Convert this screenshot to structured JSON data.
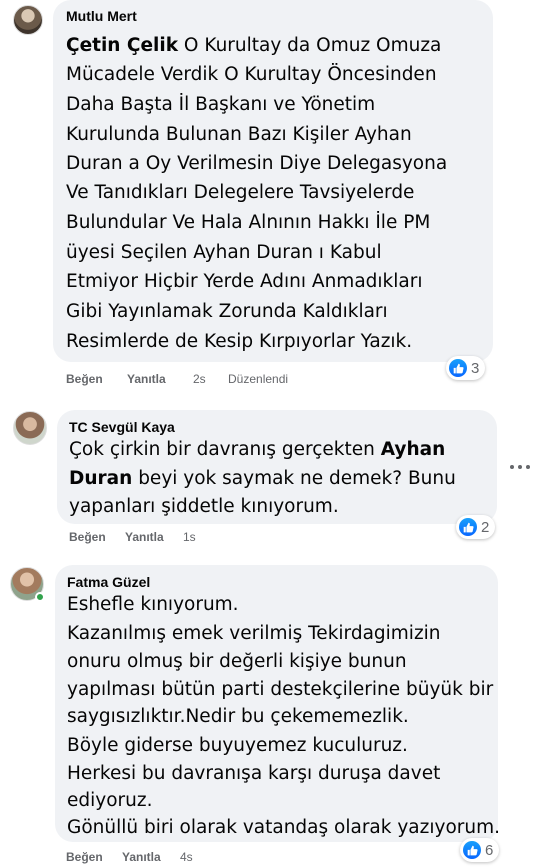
{
  "comments": [
    {
      "author": "Mutlu Mert",
      "mention": "Çetin Çelik",
      "lines": [
        " O Kurultay da Omuz Omuza",
        "Mücadele Verdik O Kurultay Öncesinden",
        "Daha Başta İl Başkanı ve Yönetim",
        "Kurulunda Bulunan Bazı Kişiler Ayhan",
        "Duran a Oy Verilmesin Diye Delegasyona",
        "Ve Tanıdıkları Delegelere Tavsiyelerde",
        "Bulundular Ve Hala Alnının Hakkı İle PM",
        "üyesi Seçilen Ayhan Duran ı Kabul",
        "Etmiyor Hiçbir Yerde Adını Anmadıkları",
        "Gibi Yayınlamak Zorunda Kaldıkları",
        "Resimlerde de Kesip Kırpıyorlar Yazık."
      ],
      "like_label": "Beğen",
      "reply_label": "Yanıtla",
      "time": "2s",
      "edited_label": "Düzenlendi",
      "reaction_count": "3"
    },
    {
      "author": "TC Sevgül Kaya",
      "line1": "Çok çirkin bir davranış gerçekten ",
      "line1_bold": "Ayhan",
      "line2_bold": "Duran",
      "line2": " beyi yok saymak ne demek? Bunu",
      "line3": "yapanları şiddetle kınıyorum.",
      "like_label": "Beğen",
      "reply_label": "Yanıtla",
      "time": "1s",
      "reaction_count": "2"
    },
    {
      "author": "Fatma Güzel",
      "lines": [
        "Eshefle kınıyorum.",
        "Kazanılmış emek verilmiş Tekirdagimizin",
        "onuru olmuş bir değerli kişiye bunun",
        "yapılması bütün parti destekçilerine büyük bir",
        "saygısızlıktır.Nedir bu çekememezlik.",
        "Böyle giderse buyuyemez kuculuruz.",
        "Herkesi bu davranışa karşı duruşa davet",
        "ediyoruz.",
        "Gönüllü biri olarak vatandaş olarak yazıyorum."
      ],
      "like_label": "Beğen",
      "reply_label": "Yanıtla",
      "time": "4s",
      "reaction_count": "6"
    }
  ]
}
